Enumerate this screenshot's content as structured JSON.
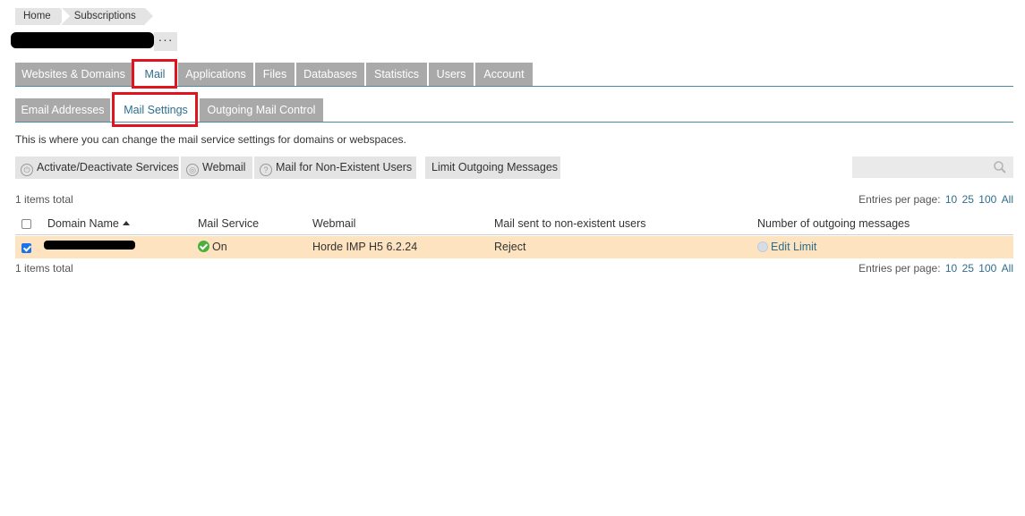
{
  "breadcrumb": {
    "home": "Home",
    "subscriptions": "Subscriptions"
  },
  "header": {
    "more_label": "···"
  },
  "main_tabs": [
    {
      "label": "Websites & Domains",
      "active": false
    },
    {
      "label": "Mail",
      "active": true
    },
    {
      "label": "Applications",
      "active": false
    },
    {
      "label": "Files",
      "active": false
    },
    {
      "label": "Databases",
      "active": false
    },
    {
      "label": "Statistics",
      "active": false
    },
    {
      "label": "Users",
      "active": false
    },
    {
      "label": "Account",
      "active": false
    }
  ],
  "sub_tabs": [
    {
      "label": "Email Addresses",
      "active": false
    },
    {
      "label": "Mail Settings",
      "active": true
    },
    {
      "label": "Outgoing Mail Control",
      "active": false
    }
  ],
  "description": "This is where you can change the mail service settings for domains or webspaces.",
  "toolbar": {
    "activate": "Activate/Deactivate Services",
    "webmail": "Webmail",
    "non_existent": "Mail for Non-Existent Users",
    "limit": "Limit Outgoing Messages"
  },
  "search": {
    "placeholder": ""
  },
  "list": {
    "items_total": "1 items total",
    "entries_label": "Entries per page:",
    "page_sizes": [
      "10",
      "25",
      "100",
      "All"
    ]
  },
  "table": {
    "headers": {
      "domain": "Domain Name",
      "mail_service": "Mail Service",
      "webmail": "Webmail",
      "non_existent": "Mail sent to non-existent users",
      "outgoing": "Number of outgoing messages"
    },
    "rows": [
      {
        "checked": true,
        "mail_service": "On",
        "webmail": "Horde IMP H5 6.2.24",
        "non_existent": "Reject",
        "outgoing": "Edit Limit"
      }
    ]
  },
  "colors": {
    "tab_inactive": "#a9a9a9",
    "accent_link": "#2e6e8d",
    "row_selected": "#fde3c0",
    "highlight_box": "#e0141e",
    "status_on": "#4caf3b"
  }
}
